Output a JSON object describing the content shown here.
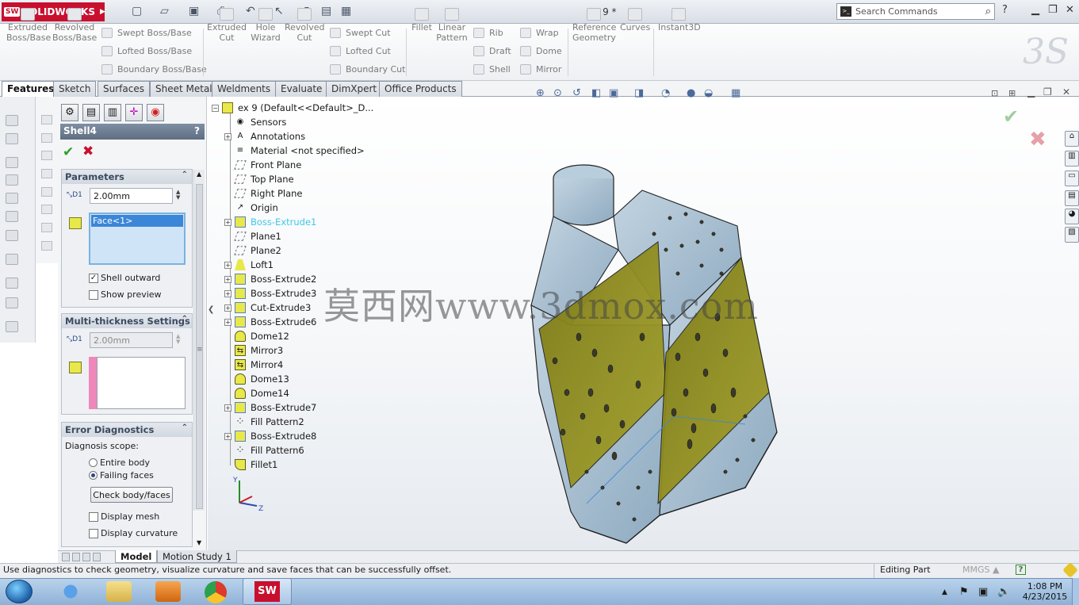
{
  "app": {
    "brand": "SOLIDWORKS",
    "doc_title": "ex 9 *"
  },
  "search": {
    "placeholder": "Search Commands"
  },
  "ribbon": {
    "features": [
      "Extruded\nBoss/Base",
      "Revolved\nBoss/Base",
      "Swept Boss/Base",
      "Lofted Boss/Base",
      "Boundary Boss/Base",
      "Extruded\nCut",
      "Hole\nWizard",
      "Revolved\nCut",
      "Swept Cut",
      "Lofted Cut",
      "Boundary Cut",
      "Fillet",
      "Linear\nPattern",
      "Rib",
      "Draft",
      "Shell",
      "Wrap",
      "Dome",
      "Mirror",
      "Reference\nGeometry",
      "Curves",
      "Instant3D"
    ]
  },
  "tabs": [
    "Features",
    "Sketch",
    "Surfaces",
    "Sheet Metal",
    "Weldments",
    "Evaluate",
    "DimXpert",
    "Office Products"
  ],
  "pm": {
    "title": "Shell4",
    "help": "?",
    "params_header": "Parameters",
    "thickness": "2.00mm",
    "faces": [
      "Face<1>"
    ],
    "shell_outward": "Shell outward",
    "show_preview": "Show preview",
    "multi_header": "Multi-thickness Settings",
    "multi_thickness": "2.00mm",
    "error_header": "Error Diagnostics",
    "diag_scope": "Diagnosis scope:",
    "entire_body": "Entire body",
    "failing_faces": "Failing faces",
    "check_btn": "Check body/faces",
    "display_mesh": "Display mesh",
    "display_curvature": "Display curvature"
  },
  "tree": {
    "root": "ex 9  (Default<<Default>_D...",
    "items": [
      "Sensors",
      "Annotations",
      "Material <not specified>",
      "Front Plane",
      "Top Plane",
      "Right Plane",
      "Origin",
      "Boss-Extrude1",
      "Plane1",
      "Plane2",
      "Loft1",
      "Boss-Extrude2",
      "Boss-Extrude3",
      "Cut-Extrude3",
      "Boss-Extrude6",
      "Dome12",
      "Mirror3",
      "Mirror4",
      "Dome13",
      "Dome14",
      "Boss-Extrude7",
      "Fill Pattern2",
      "Boss-Extrude8",
      "Fill Pattern6",
      "Fillet1"
    ]
  },
  "triad": {
    "y": "Y",
    "z": "Z"
  },
  "bottom_tabs": [
    "Model",
    "Motion Study 1"
  ],
  "status": {
    "message": "Use diagnostics to check geometry, visualize curvature and save faces that can be successfully offset.",
    "mode": "Editing Part",
    "units": "MMGS"
  },
  "watermark": "莫西网www.3dmox.com",
  "clock": {
    "time": "1:08 PM",
    "date": "4/23/2015"
  },
  "colors": {
    "selection": "#3b86d8",
    "accent": "#c8102e",
    "ok": "#2aa02a",
    "face_yellow": "#8b8a18",
    "body_blue": "#9fb9cc"
  }
}
